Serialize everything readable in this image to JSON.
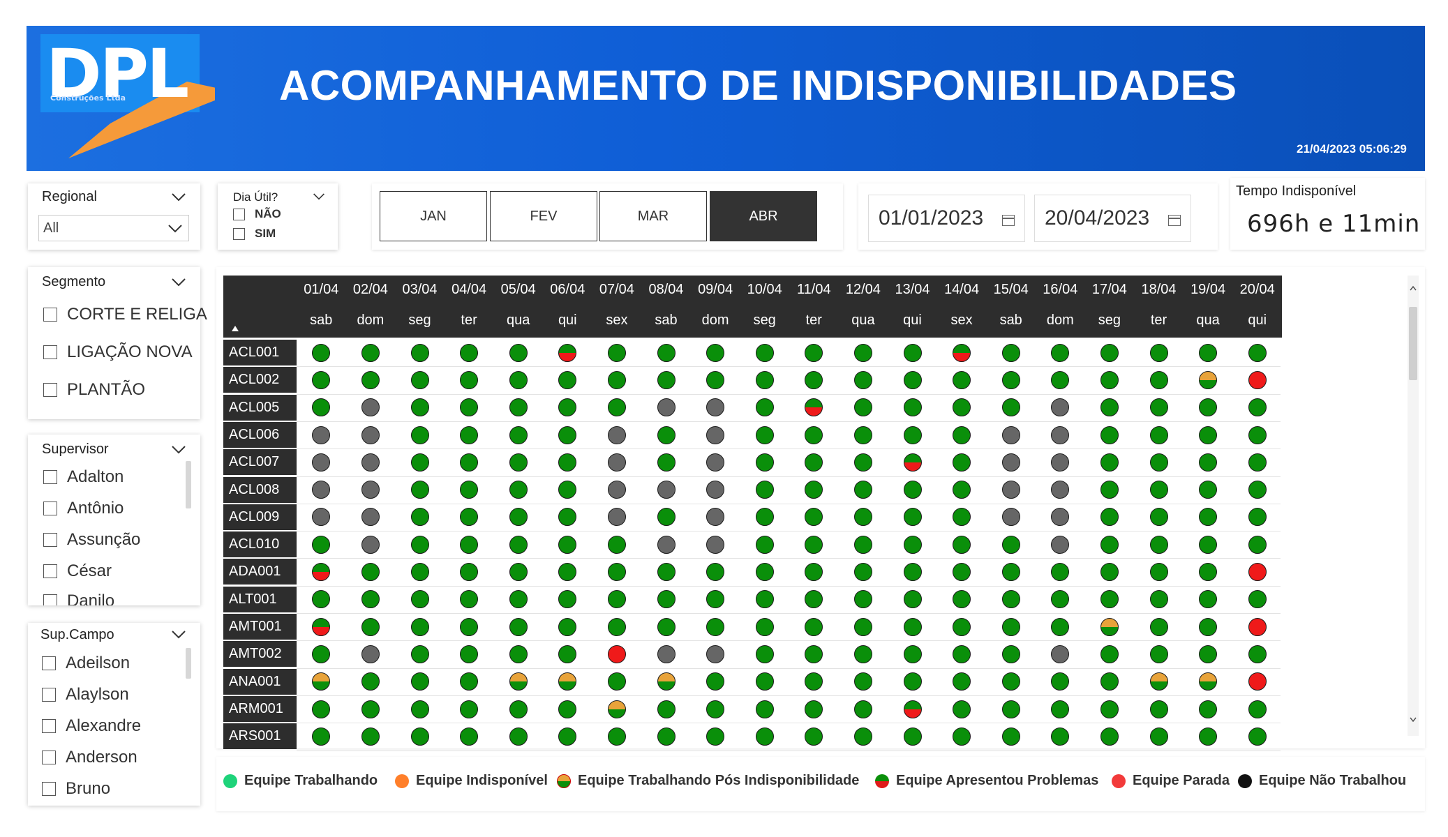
{
  "header": {
    "logo_text": "DPL",
    "logo_subtitle": "Construções Ltda",
    "title": "ACOMPANHAMENTO DE INDISPONIBILIDADES",
    "timestamp": "21/04/2023 05:06:29"
  },
  "filters": {
    "regional": {
      "label": "Regional",
      "value": "All"
    },
    "dia_util": {
      "label": "Dia Útil?",
      "options": [
        "NÃO",
        "SIM"
      ]
    },
    "segmento": {
      "label": "Segmento",
      "options": [
        "CORTE E RELIGA",
        "LIGAÇÃO NOVA",
        "PLANTÃO"
      ]
    },
    "supervisor": {
      "label": "Supervisor",
      "options": [
        "Adalton",
        "Antônio",
        "Assunção",
        "César",
        "Danilo"
      ]
    },
    "sup_campo": {
      "label": "Sup.Campo",
      "options": [
        "Adeilson",
        "Alaylson",
        "Alexandre",
        "Anderson",
        "Bruno"
      ]
    }
  },
  "months": {
    "items": [
      "JAN",
      "FEV",
      "MAR",
      "ABR"
    ],
    "active": "ABR"
  },
  "date_range": {
    "start": "01/01/2023",
    "end": "20/04/2023"
  },
  "kpi": {
    "label": "Tempo Indisponível",
    "value": "696h e 11min"
  },
  "matrix": {
    "dates": [
      "01/04",
      "02/04",
      "03/04",
      "04/04",
      "05/04",
      "06/04",
      "07/04",
      "08/04",
      "09/04",
      "10/04",
      "11/04",
      "12/04",
      "13/04",
      "14/04",
      "15/04",
      "16/04",
      "17/04",
      "18/04",
      "19/04",
      "20/04"
    ],
    "weekdays": [
      "sab",
      "dom",
      "seg",
      "ter",
      "qua",
      "qui",
      "sex",
      "sab",
      "dom",
      "seg",
      "ter",
      "qua",
      "qui",
      "sex",
      "sab",
      "dom",
      "seg",
      "ter",
      "qua",
      "qui"
    ],
    "status_legend": {
      "G": "trabalhando",
      "X": "nao-trabalhou",
      "R": "parada",
      "P": "apresentou-problemas",
      "Y": "pos-indisponibilidade"
    },
    "rows": [
      {
        "team": "ACL001",
        "cells": "GGGGGPGGGGGGGPGGGGGG"
      },
      {
        "team": "ACL002",
        "cells": "GGGGGGGGGGGGGGGGGGYR"
      },
      {
        "team": "ACL005",
        "cells": "GXGGGGGXXGPGGGGXGGGG"
      },
      {
        "team": "ACL006",
        "cells": "XXGGGGXGXGGGGGXXGGGG"
      },
      {
        "team": "ACL007",
        "cells": "XXGGGGXGXGGGPGXXGGGG"
      },
      {
        "team": "ACL008",
        "cells": "XXGGGGXXXGGGGGXXGGGG"
      },
      {
        "team": "ACL009",
        "cells": "XXGGGGXGXGGGGGXXGGGG"
      },
      {
        "team": "ACL010",
        "cells": "GXGGGGGXXGGGGGGXGGGG"
      },
      {
        "team": "ADA001",
        "cells": "PGGGGGGGGGGGGGGGGGGR"
      },
      {
        "team": "ALT001",
        "cells": "GGGGGGGGGGGGGGGGGGGG"
      },
      {
        "team": "AMT001",
        "cells": "PGGGGGGGGGGGGGGGYGGR"
      },
      {
        "team": "AMT002",
        "cells": "GXGGGGRXXGGGGGGXGGGG"
      },
      {
        "team": "ANA001",
        "cells": "YGGGYYGYGGGGGGGGGYYR"
      },
      {
        "team": "ARM001",
        "cells": "GGGGGGYGGGGGPGGGGGGG"
      },
      {
        "team": "ARS001",
        "cells": "GGGGGGGGGGGGGGGGGGGG"
      }
    ]
  },
  "legend": [
    {
      "label": "Equipe Trabalhando",
      "color": "#1ed37a"
    },
    {
      "label": "Equipe Indisponível",
      "color": "#ff7f2a"
    },
    {
      "label": "Equipe Trabalhando Pós Indisponibilidade",
      "color": "#e8a33a"
    },
    {
      "label": "Equipe Apresentou Problemas",
      "color": "#e01b1b"
    },
    {
      "label": "Equipe Parada",
      "color": "#f23a3a"
    },
    {
      "label": "Equipe Não Trabalhou",
      "color": "#111111"
    }
  ],
  "colors": {
    "header_blue": "#0f5ed6",
    "dot_green": "#0a8f0a",
    "dot_gray": "#666666",
    "dot_red": "#ef1a1a",
    "dot_yellow": "#e8a33a"
  }
}
